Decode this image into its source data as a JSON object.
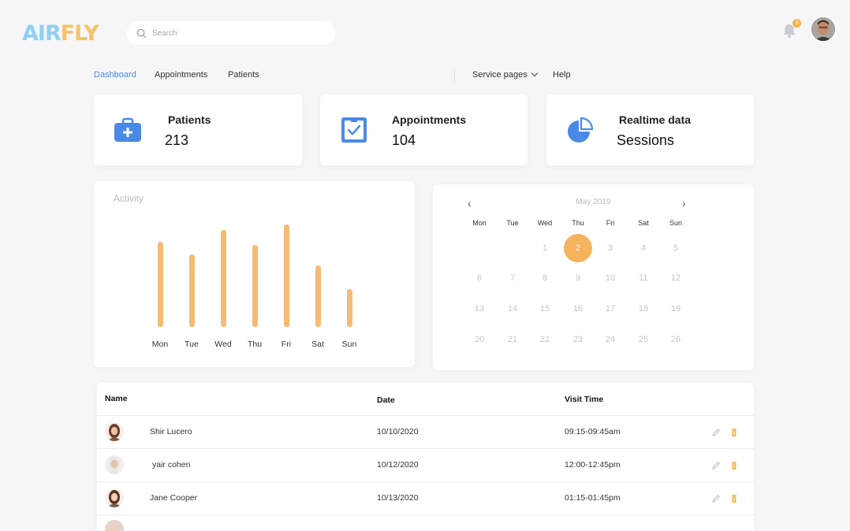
{
  "brand": {
    "logo_left": "AIR",
    "logo_right": "FLY"
  },
  "header": {
    "search_placeholder": "Search",
    "notification_count": "3"
  },
  "nav": {
    "items": [
      "Dashboard",
      "Appointments",
      "Patients"
    ],
    "active": "Dashboard",
    "service_pages": "Service pages",
    "help": "Help"
  },
  "stats": [
    {
      "title": "Patients",
      "value": "213",
      "icon": "medical-kit-icon"
    },
    {
      "title": "Appointments",
      "value": "104",
      "icon": "clipboard-check-icon"
    },
    {
      "title": "Realtime data",
      "value": "Sessions",
      "icon": "pie-chart-icon"
    }
  ],
  "activity": {
    "title": "Activity",
    "chart_data": {
      "type": "bar",
      "categories": [
        "Mon",
        "Tue",
        "Wed",
        "Thu",
        "Fri",
        "Sat",
        "Sun"
      ],
      "values": [
        108,
        92,
        123,
        104,
        130,
        78,
        48
      ],
      "title": "Activity",
      "xlabel": "",
      "ylabel": "",
      "color": "#f4bb76"
    }
  },
  "calendar": {
    "month": "May 2019",
    "weekdays": [
      "Mon",
      "Tue",
      "Wed",
      "Thu",
      "Fri",
      "Sat",
      "Sun"
    ],
    "weeks": [
      [
        "",
        "",
        "1",
        "2",
        "3",
        "4",
        "5"
      ],
      [
        "6",
        "7",
        "8",
        "9",
        "10",
        "11",
        "12"
      ],
      [
        "13",
        "14",
        "15",
        "16",
        "17",
        "18",
        "19"
      ],
      [
        "20",
        "21",
        "22",
        "23",
        "24",
        "25",
        "26"
      ]
    ],
    "selected": "2",
    "selected_color": "#f4b35c"
  },
  "table": {
    "headers": {
      "name": "Name",
      "date": "Date",
      "visit_time": "Visit Time"
    },
    "rows": [
      {
        "name": "Shir Lucero",
        "date": "10/10/2020",
        "time": "09:15-09:45am"
      },
      {
        "name": "yair cohen",
        "date": "10/12/2020",
        "time": "12:00-12:45pm"
      },
      {
        "name": "Jane Cooper",
        "date": "10/13/2020",
        "time": "01:15-01:45pm"
      }
    ]
  },
  "colors": {
    "accent": "#4a8ae6",
    "bar": "#f4bb76",
    "badge": "#f3b34a",
    "delete": "#f3b34a"
  }
}
